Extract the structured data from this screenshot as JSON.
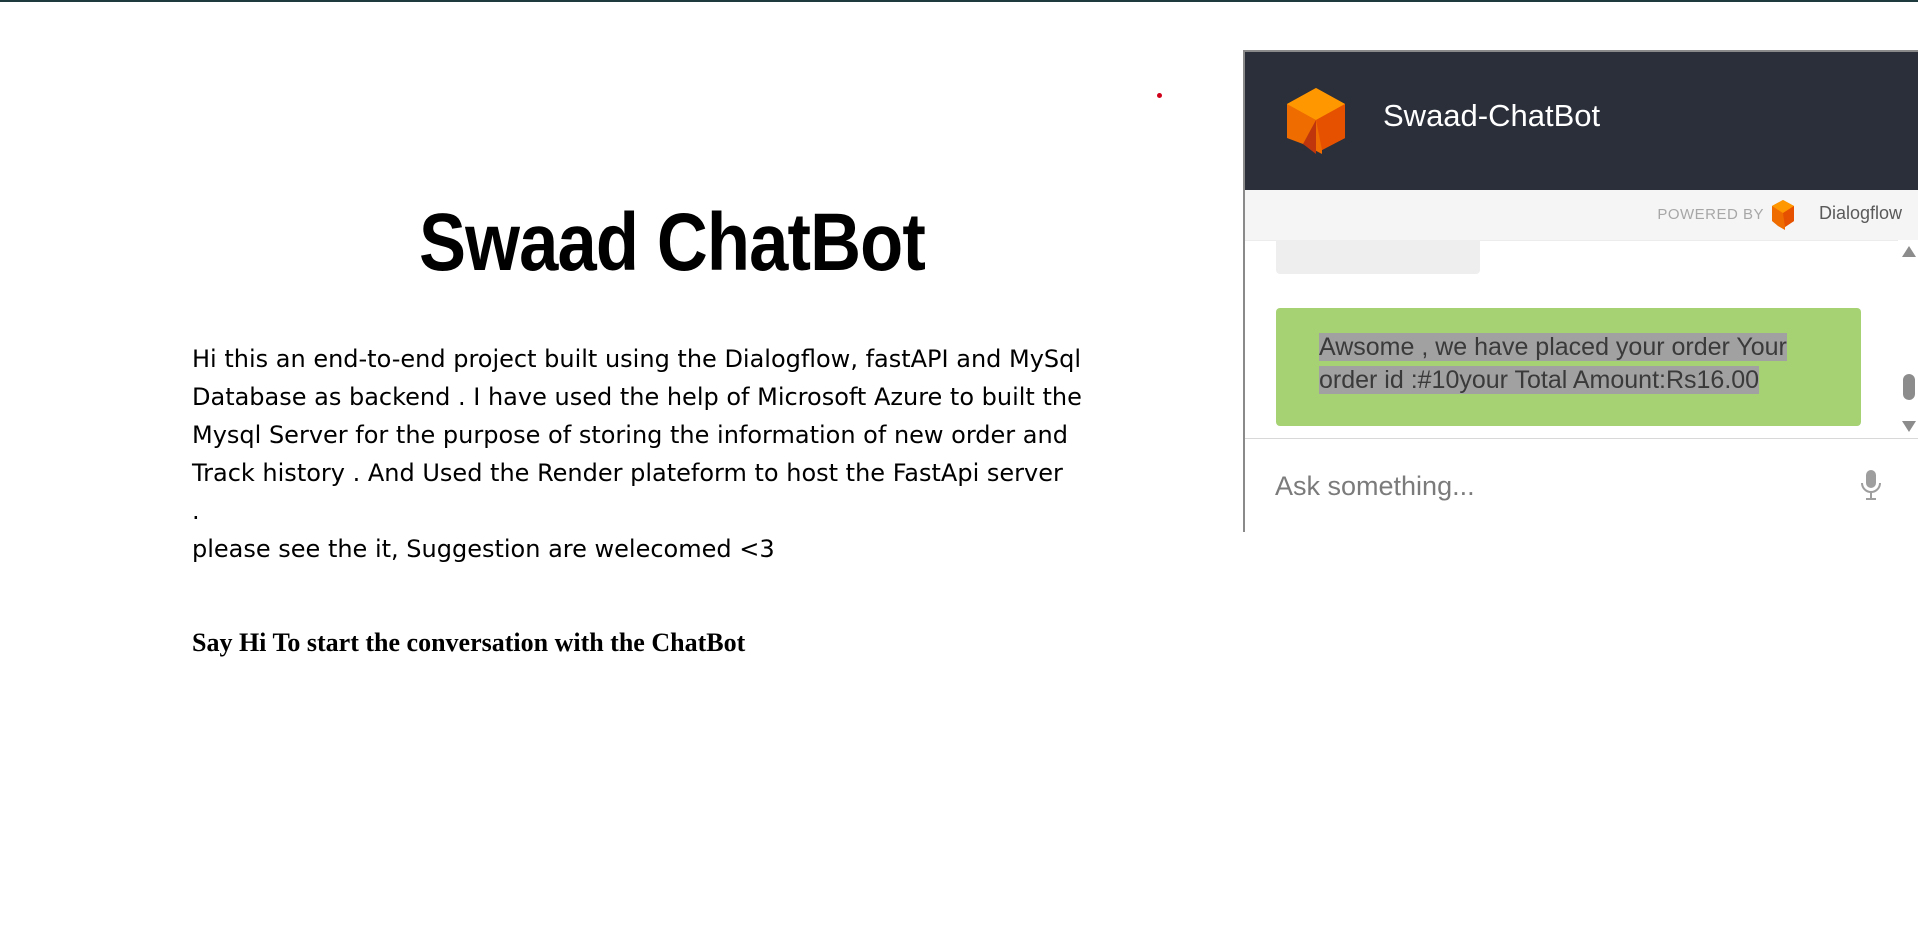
{
  "page": {
    "title": "Swaad ChatBot",
    "intro_lines": [
      "Hi this an end-to-end project built using the Dialogflow, fastAPI and MySql",
      "Database as backend . I have used the help of Microsoft Azure to built the",
      "Mysql Server for the purpose of storing the information of new order and",
      "Track history . And Used the Render plateform to host the FastApi server",
      ".",
      "please see the it, Suggestion are welecomed <3"
    ],
    "cta": "Say Hi To start the conversation with the ChatBot"
  },
  "chat": {
    "title": "Swaad-ChatBot",
    "powered_by": "POWERED BY",
    "provider": "Dialogflow",
    "bot_message": "Awsome , we have placed your order Your order id :#10your Total Amount:Rs16.00",
    "input_placeholder": "Ask something...",
    "icons": {
      "logo": "dialogflow-logo-icon",
      "mic": "microphone-icon",
      "scroll_up": "scroll-up-arrow-icon",
      "scroll_down": "scroll-down-arrow-icon"
    },
    "colors": {
      "header_bg": "#2b2f3a",
      "bubble_bg": "#a6d274",
      "logo_orange": "#ef6c00"
    }
  }
}
